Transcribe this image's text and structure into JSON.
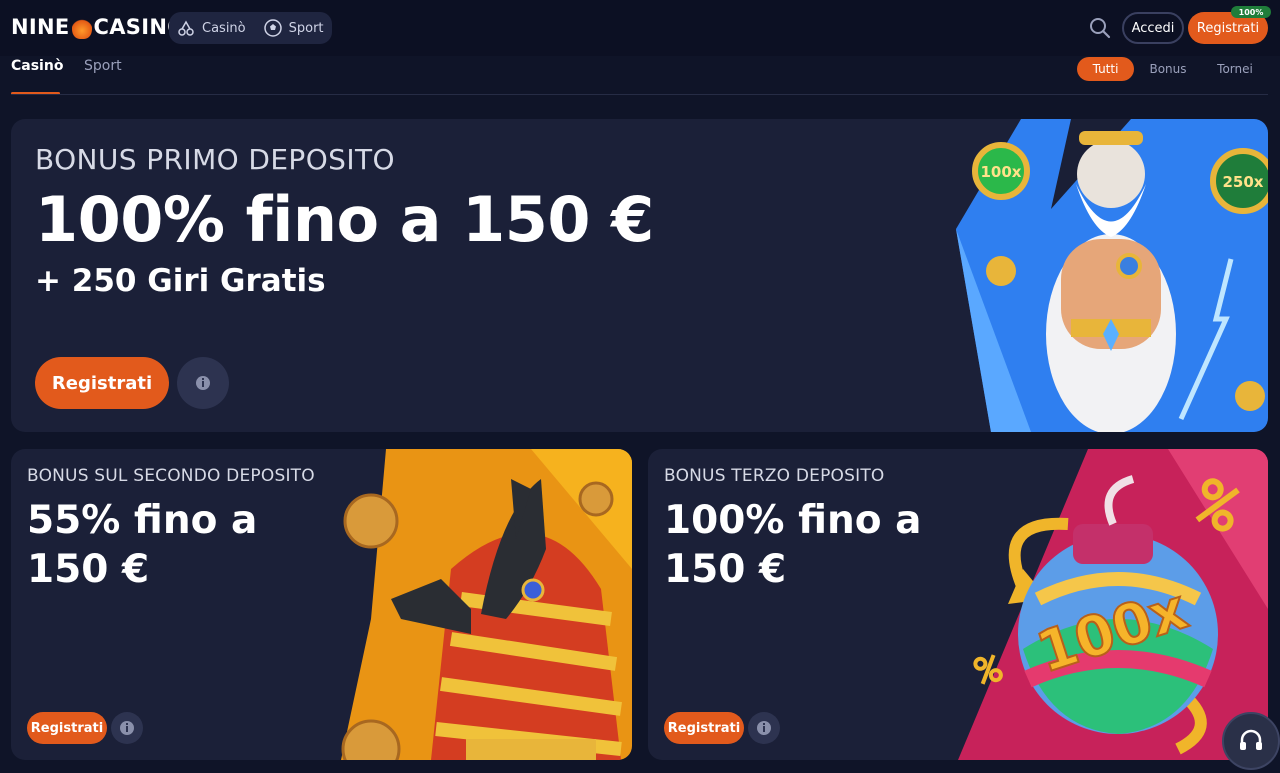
{
  "header": {
    "logo": {
      "part1": "NINE",
      "part2": "CASINO"
    },
    "nav": [
      {
        "label": "Casinò",
        "icon": "cherries-icon"
      },
      {
        "label": "Sport",
        "icon": "soccer-ball-icon"
      }
    ],
    "login_label": "Accedi",
    "register_label": "Registrati",
    "register_badge": "100%"
  },
  "subnav": {
    "tabs": [
      {
        "label": "Casinò",
        "active": true
      },
      {
        "label": "Sport",
        "active": false
      }
    ],
    "filters": [
      {
        "label": "Tutti",
        "active": true
      },
      {
        "label": "Bonus",
        "active": false
      },
      {
        "label": "Tornei",
        "active": false
      }
    ]
  },
  "promos": {
    "main": {
      "subtitle": "BONUS PRIMO DEPOSITO",
      "headline": "100% fino a 150 €",
      "extra": "+ 250 Giri Gratis",
      "cta": "Registrati",
      "coin_labels": [
        "100x",
        "250x"
      ]
    },
    "second": {
      "subtitle": "BONUS SUL SECONDO DEPOSITO",
      "headline": "55% fino a 150 €",
      "cta": "Registrati"
    },
    "third": {
      "subtitle": "BONUS TERZO DEPOSITO",
      "headline": "100% fino a 150 €",
      "cta": "Registrati",
      "bomb_label": "100x"
    }
  },
  "colors": {
    "accent": "#e25a1c",
    "background": "#0f1428",
    "card": "#1b2038"
  }
}
